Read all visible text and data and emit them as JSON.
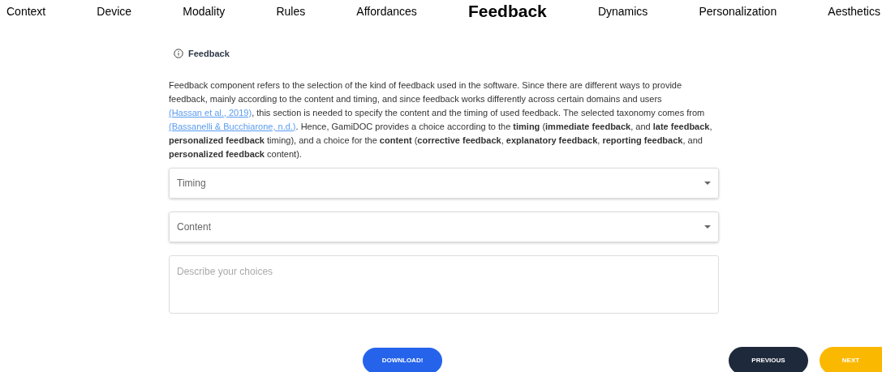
{
  "nav": [
    {
      "label": "Context",
      "selected": false
    },
    {
      "label": "Device",
      "selected": false
    },
    {
      "label": "Modality",
      "selected": false
    },
    {
      "label": "Rules",
      "selected": false
    },
    {
      "label": "Affordances",
      "selected": false
    },
    {
      "label": "Feedback",
      "selected": true
    },
    {
      "label": "Dynamics",
      "selected": false
    },
    {
      "label": "Personalization",
      "selected": false
    },
    {
      "label": "Aesthetics",
      "selected": false
    }
  ],
  "section": {
    "title": "Feedback"
  },
  "description": [
    {
      "kind": "text",
      "text": "Feedback component refers to the selection of the kind of feedback used in the software. Since there are different ways to provide feedback, mainly according to the content and timing, and since feedback works differently across certain domains and users "
    },
    {
      "kind": "link",
      "text": "(Hassan et al., 2019)"
    },
    {
      "kind": "text",
      "text": ", this section is needed to specify the content and the timing of used feedback. The selected taxonomy comes from "
    },
    {
      "kind": "link",
      "text": "(Bassanelli & Bucchiarone, n.d.)"
    },
    {
      "kind": "text",
      "text": ". Hence, GamiDOC provides a choice according to the **timing** (**immediate feedback**, and **late feedback**, **personalized feedback** timing), and a choice for the **content** (**corrective feedback**, **explanatory feedback**, **reporting feedback**, and **personalized feedback** content)."
    }
  ],
  "selects": [
    {
      "placeholder": "Timing"
    },
    {
      "placeholder": "Content"
    }
  ],
  "textarea": {
    "placeholder": "Describe your choices"
  },
  "buttons": {
    "download": "DOWNLOAD!",
    "previous": "PREVIOUS",
    "next": "NEXT"
  }
}
